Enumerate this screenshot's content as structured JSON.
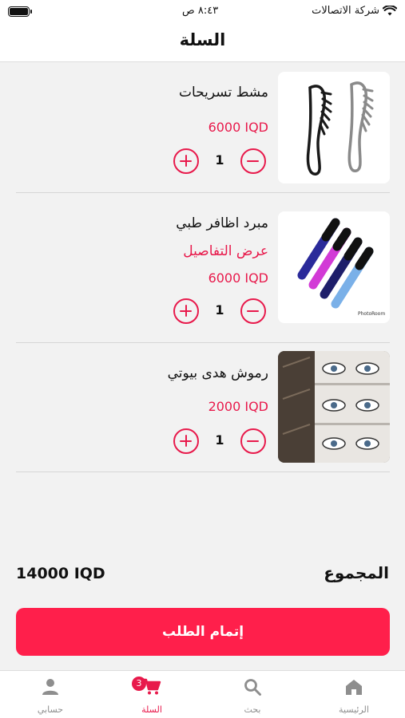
{
  "status": {
    "carrier": "شركة الاتصالات",
    "time": "٨:٤٣ ص"
  },
  "header": {
    "title": "السلة"
  },
  "items": [
    {
      "name": "مشط تسريحات",
      "link": "",
      "price": "6000 IQD",
      "quantity": "1",
      "image": "comb-image"
    },
    {
      "name": "مبرد اظافر طبي",
      "link": "عرض التفاصيل",
      "price": "6000 IQD",
      "quantity": "1",
      "image": "nail-file-image",
      "image_caption": "PhotoRoom"
    },
    {
      "name": "رموش هدى بيوتي",
      "link": "",
      "price": "2000 IQD",
      "quantity": "1",
      "image": "eyelashes-image"
    }
  ],
  "summary": {
    "total_label": "المجموع",
    "total_value": "14000 IQD"
  },
  "checkout": {
    "label": "إتمام الطلب"
  },
  "tabs": [
    {
      "label": "الرئيسية",
      "icon": "home-icon"
    },
    {
      "label": "بحث",
      "icon": "search-icon"
    },
    {
      "label": "السلة",
      "icon": "cart-icon",
      "badge": "3",
      "active": true
    },
    {
      "label": "حسابي",
      "icon": "user-icon"
    }
  ],
  "colors": {
    "accent": "#e8194b",
    "button": "#ff1f4b",
    "background": "#f2f2f2"
  }
}
